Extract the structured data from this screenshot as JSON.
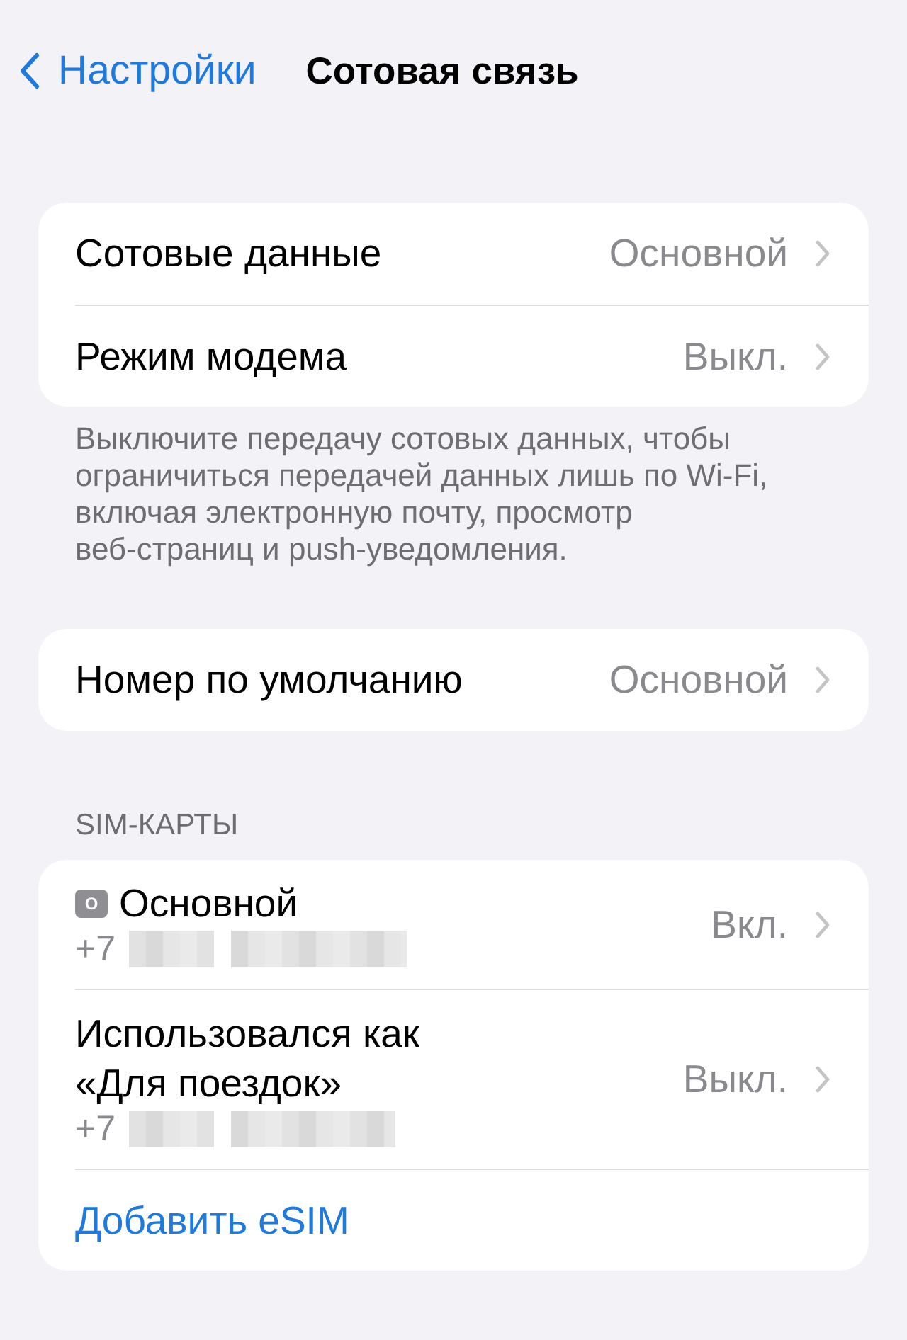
{
  "nav": {
    "back_label": "Настройки",
    "title": "Сотовая связь"
  },
  "groups": [
    {
      "items": [
        {
          "kind": "value",
          "label": "Сотовые данные",
          "value": "Основной"
        },
        {
          "kind": "value",
          "label": "Режим модема",
          "value": "Выкл."
        }
      ],
      "footer": "Выключите передачу сотовых данных, чтобы\nограничиться передачей данных лишь по Wi-Fi,\nвключая электронную почту, просмотр\nвеб-страниц и push-уведомления."
    },
    {
      "items": [
        {
          "kind": "value",
          "label": "Номер по умолчанию",
          "value": "Основной"
        }
      ]
    },
    {
      "header": "SIM-КАРТЫ",
      "items": [
        {
          "kind": "sim",
          "badge": "О",
          "label": "Основной",
          "number": "+7",
          "value": "Вкл."
        },
        {
          "kind": "sim",
          "label": "Использовался как\n«Для поездок»",
          "number": "+7",
          "value": "Выкл."
        },
        {
          "kind": "action",
          "label": "Добавить eSIM"
        }
      ]
    }
  ]
}
